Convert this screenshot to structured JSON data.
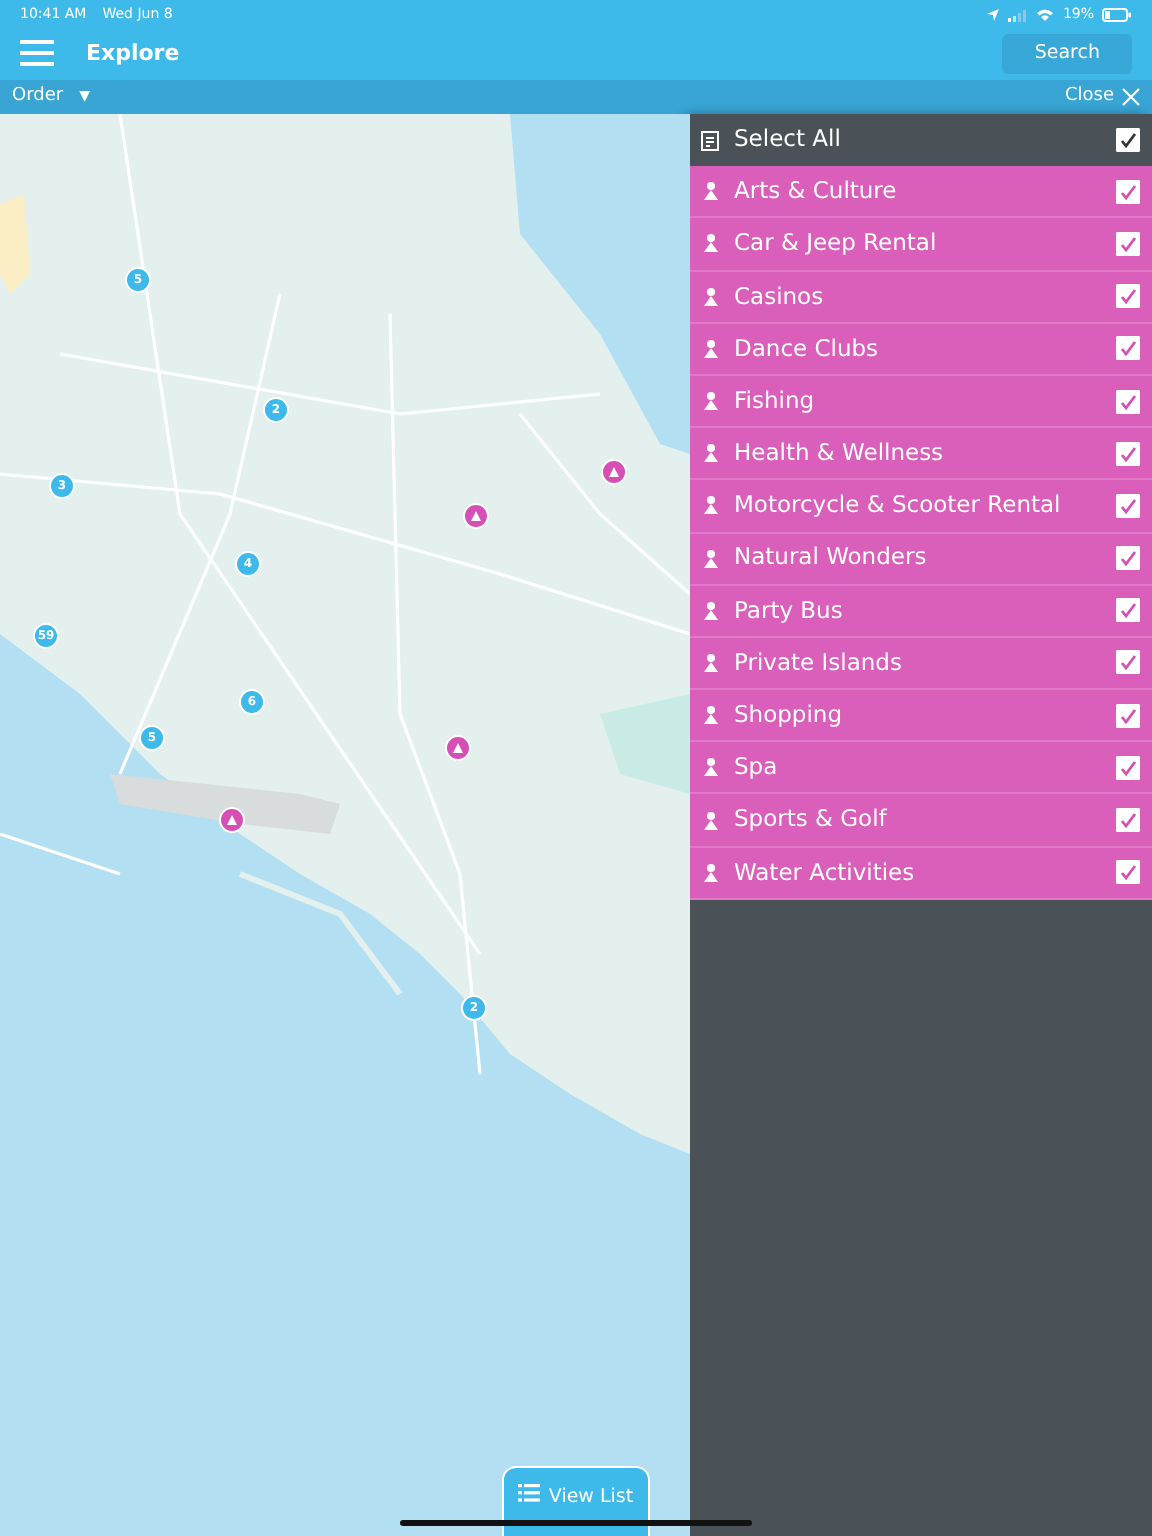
{
  "status_bar": {
    "time": "10:41 AM",
    "date": "Wed Jun 8",
    "battery": "19%"
  },
  "header": {
    "title": "Explore",
    "search_button": "Search"
  },
  "toolbar": {
    "order": "Order",
    "order_caret": "▼",
    "close": "Close"
  },
  "map": {
    "kind": "picture",
    "clusters": [
      {
        "count": "5"
      },
      {
        "count": "2"
      },
      {
        "count": "3"
      },
      {
        "count": "4"
      },
      {
        "count": "59"
      },
      {
        "count": "6"
      },
      {
        "count": "5"
      },
      {
        "count": "2"
      }
    ]
  },
  "filter_panel": {
    "select_all": {
      "label": "Select All",
      "checked": true
    },
    "categories": [
      {
        "label": "Arts & Culture",
        "checked": true
      },
      {
        "label": "Car & Jeep Rental",
        "checked": true
      },
      {
        "label": "Casinos",
        "checked": true
      },
      {
        "label": "Dance Clubs",
        "checked": true
      },
      {
        "label": "Fishing",
        "checked": true
      },
      {
        "label": "Health & Wellness",
        "checked": true
      },
      {
        "label": "Motorcycle & Scooter Rental",
        "checked": true
      },
      {
        "label": "Natural Wonders",
        "checked": true
      },
      {
        "label": "Party Bus",
        "checked": true
      },
      {
        "label": "Private Islands",
        "checked": true
      },
      {
        "label": "Shopping",
        "checked": true
      },
      {
        "label": "Spa",
        "checked": true
      },
      {
        "label": "Sports & Golf",
        "checked": true
      },
      {
        "label": "Water Activities",
        "checked": true
      }
    ]
  },
  "view_list_button": "View List"
}
